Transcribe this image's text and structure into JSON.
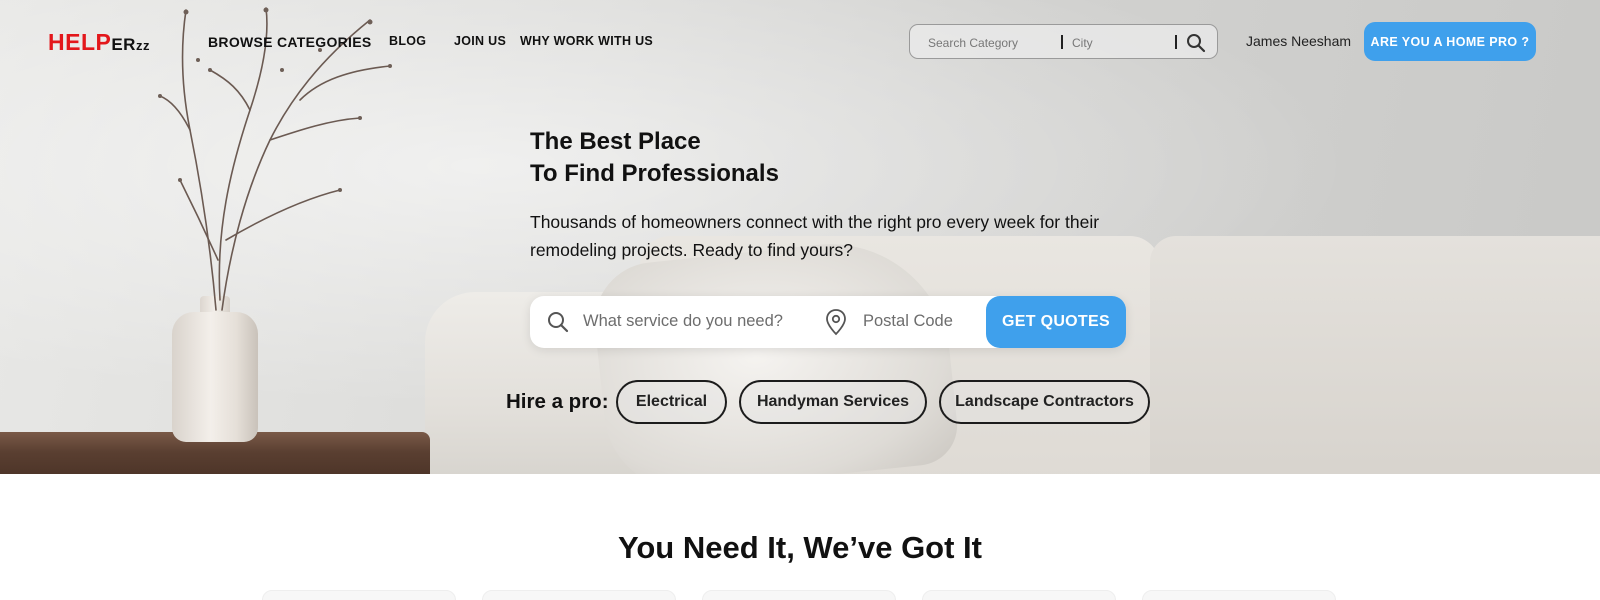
{
  "header": {
    "logo": {
      "part1": "HELP",
      "part2": "ER",
      "part3": "zz"
    },
    "nav": [
      {
        "label": "BROWSE CATEGORIES"
      },
      {
        "label": "BLOG"
      },
      {
        "label": "JOIN US"
      },
      {
        "label": "WHY WORK WITH US"
      }
    ],
    "search": {
      "category_placeholder": "Search Category",
      "city_placeholder": "City",
      "icon": "search-icon"
    },
    "user_name": "James Neesham",
    "pro_button": "ARE YOU A HOME PRO ?"
  },
  "hero": {
    "title_line1": "The Best Place",
    "title_line2": "To Find Professionals",
    "subtitle": "Thousands of homeowners connect with the right pro every week for their remodeling projects. Ready to find yours?",
    "search": {
      "service_placeholder": "What service do you need?",
      "postal_placeholder": "Postal Code",
      "button": "GET QUOTES",
      "icons": [
        "search-icon",
        "location-pin-icon"
      ]
    },
    "hire_label": "Hire a pro:",
    "chips": [
      "Electrical",
      "Handyman Services",
      "Landscape Contractors"
    ]
  },
  "section": {
    "title": "You Need It, We’ve Got It"
  },
  "colors": {
    "accent": "#3fa0ec",
    "logo_red": "#e3171b"
  }
}
